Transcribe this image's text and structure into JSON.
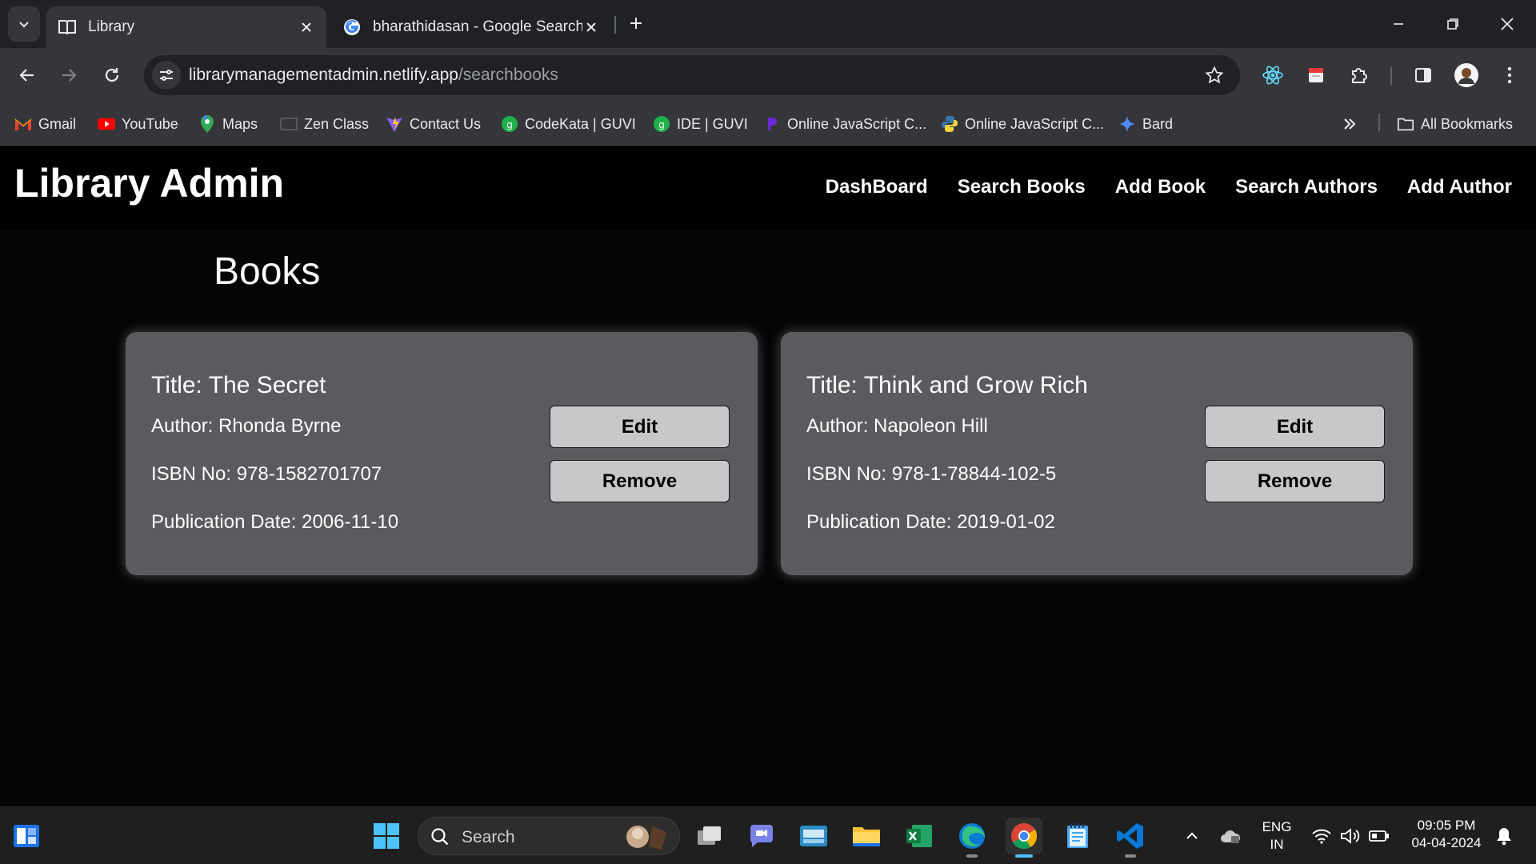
{
  "browser": {
    "tabs": [
      {
        "title": "Library",
        "active": true
      },
      {
        "title": "bharathidasan - Google Search",
        "active": false
      }
    ],
    "url_host": "librarymanagementadmin.netlify.app",
    "url_path": "/searchbooks",
    "bookmarks": [
      {
        "label": "Gmail",
        "icon": "gmail-icon"
      },
      {
        "label": "YouTube",
        "icon": "youtube-icon"
      },
      {
        "label": "Maps",
        "icon": "maps-icon"
      },
      {
        "label": "Zen Class",
        "icon": "zen-class-icon"
      },
      {
        "label": "Contact Us",
        "icon": "vite-icon"
      },
      {
        "label": "CodeKata | GUVI",
        "icon": "guvi-icon"
      },
      {
        "label": "IDE | GUVI",
        "icon": "guvi-icon"
      },
      {
        "label": "Online JavaScript C...",
        "icon": "onecompiler-icon"
      },
      {
        "label": "Online JavaScript C...",
        "icon": "python-icon"
      },
      {
        "label": "Bard",
        "icon": "bard-icon"
      }
    ],
    "all_bookmarks_label": "All Bookmarks"
  },
  "site": {
    "brand": "Library Admin",
    "nav": [
      "DashBoard",
      "Search Books",
      "Add Book",
      "Search Authors",
      "Add Author"
    ]
  },
  "page": {
    "heading": "Books",
    "books": [
      {
        "title": "Title: The Secret",
        "author": "Author: Rhonda Byrne",
        "isbn": "ISBN No: 978-1582701707",
        "publication_date": "Publication Date: 2006-11-10",
        "edit_label": "Edit",
        "remove_label": "Remove"
      },
      {
        "title": "Title: Think and Grow Rich",
        "author": "Author: Napoleon Hill",
        "isbn": "ISBN No: 978-1-78844-102-5",
        "publication_date": "Publication Date: 2019-01-02",
        "edit_label": "Edit",
        "remove_label": "Remove"
      }
    ]
  },
  "taskbar": {
    "search_label": "Search",
    "lang_line1": "ENG",
    "lang_line2": "IN",
    "time": "09:05 PM",
    "date": "04-04-2024"
  },
  "colors": {
    "page_bg": "#000000",
    "card_bg": "#5b5b5f",
    "button_bg": "#c8c8c8",
    "browser_bar": "#35363a",
    "accent": "#4cc2ff"
  }
}
